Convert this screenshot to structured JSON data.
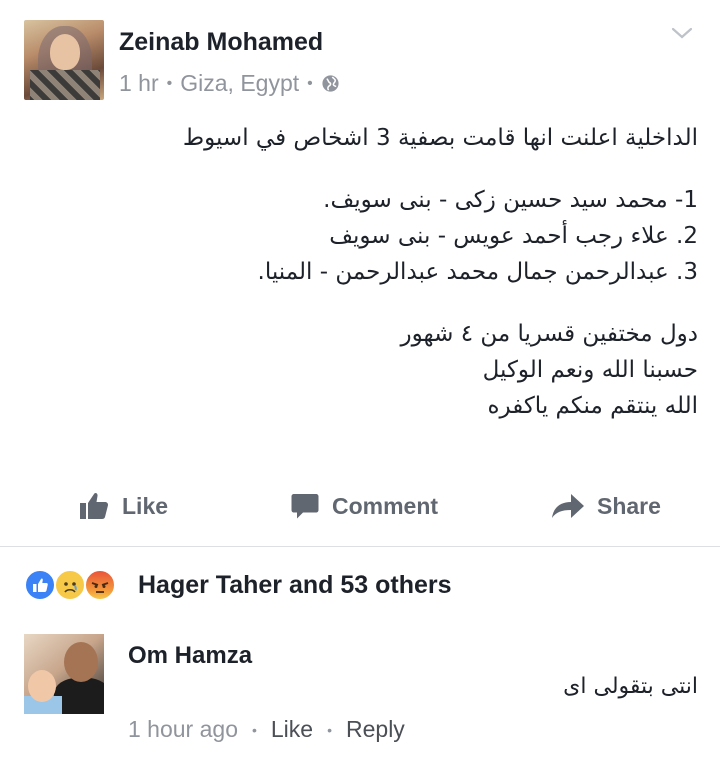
{
  "post": {
    "author": "Zeinab Mohamed",
    "time": "1 hr",
    "location": "Giza, Egypt",
    "privacy_icon": "globe-icon",
    "lines": [
      "الداخلية اعلنت انها قامت بصفية 3 اشخاص في اسيوط",
      "",
      "1- محمد سيد حسين زكى -  بنى سويف.",
      "2. علاء رجب أحمد عويس - بنى سويف",
      "3. عبدالرحمن جمال محمد عبدالرحمن - المنيا.",
      "",
      "دول مختفين قسريا من ٤ شهور",
      "حسبنا الله ونعم الوكيل",
      "الله ينتقم منكم ياكفره"
    ]
  },
  "actions": {
    "like": "Like",
    "comment": "Comment",
    "share": "Share"
  },
  "reactions": {
    "types": [
      "like",
      "sad",
      "angry"
    ],
    "summary": "Hager Taher and 53 others"
  },
  "comment": {
    "author": "Om Hamza",
    "text": "انتى بتقولى اى",
    "time": "1 hour ago",
    "like_label": "Like",
    "reply_label": "Reply"
  },
  "colors": {
    "text_primary": "#1d2129",
    "text_secondary": "#90949c",
    "action_gray": "#616770",
    "like_blue": "#3b82f6",
    "divider": "#dddfe2"
  }
}
